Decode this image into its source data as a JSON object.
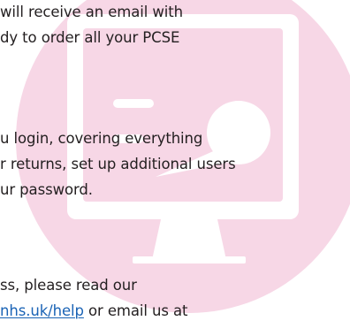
{
  "watermark": {
    "icon": "monitor-icon",
    "circle_color": "#f7d7e6",
    "screen_color": "#ffffff"
  },
  "text": {
    "para1_line1": "will receive an email with",
    "para1_line2": "dy to order all your PCSE",
    "para2_line1": "u login, covering everything",
    "para2_line2": "r returns, set up additional users",
    "para2_line3": "ur password.",
    "para3_line1": "ss, please read our",
    "para3_link": "nhs.uk/help",
    "para3_line2_rest": " or email us at"
  },
  "colors": {
    "body_text": "#231f20",
    "link": "#1a63b5"
  }
}
